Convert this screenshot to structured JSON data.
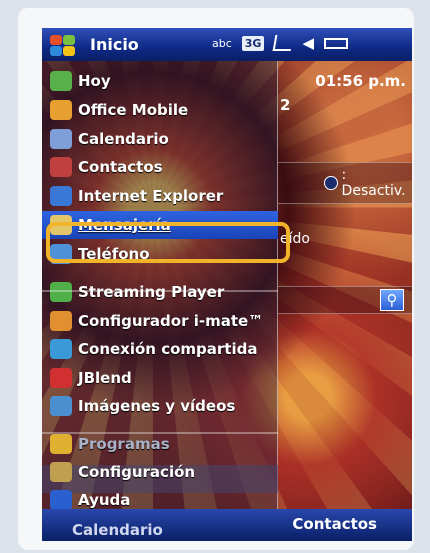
{
  "title_bar": {
    "title": "Inicio",
    "abc": "abc",
    "network": "3G"
  },
  "today": {
    "time": "01:56 p.m.",
    "date_fragment": "2",
    "bluetooth": ": Desactiv.",
    "messages_fragment": "eído"
  },
  "softkeys": {
    "left": "Calendario",
    "right": "Contactos"
  },
  "start_menu": {
    "items": [
      {
        "label": "Hoy",
        "icon": "today-icon",
        "color": "#58b04a"
      },
      {
        "label": "Office Mobile",
        "icon": "office-icon",
        "color": "#e8a030"
      },
      {
        "label": "Calendario",
        "icon": "calendar-icon",
        "color": "#7f9fd8"
      },
      {
        "label": "Contactos",
        "icon": "contacts-icon",
        "color": "#c04040"
      },
      {
        "label": "Internet Explorer",
        "icon": "ie-icon",
        "color": "#3a78d8"
      },
      {
        "label": "Mensajería",
        "icon": "messaging-icon",
        "color": "#e3c66a"
      },
      {
        "label": "Teléfono",
        "icon": "phone-icon",
        "color": "#4f92d8"
      },
      {
        "label": "Streaming Player",
        "icon": "streaming-icon",
        "color": "#4fb04a"
      },
      {
        "label": "Configurador i-mate™",
        "icon": "configurator-icon",
        "color": "#e09030"
      },
      {
        "label": "Conexión compartida",
        "icon": "sharing-icon",
        "color": "#3a9ad8"
      },
      {
        "label": "JBlend",
        "icon": "jblend-icon",
        "color": "#d03030"
      },
      {
        "label": "Imágenes y vídeos",
        "icon": "pictures-icon",
        "color": "#4a8fd0"
      },
      {
        "label": "Programas",
        "icon": "programs-icon",
        "color": "#e0b030"
      },
      {
        "label": "Configuración",
        "icon": "settings-icon",
        "color": "#c0a050"
      },
      {
        "label": "Ayuda",
        "icon": "help-icon",
        "color": "#2a5fd0"
      }
    ]
  },
  "colors": {
    "highlight": "#f0b32a",
    "selected": "#2f63e0"
  }
}
